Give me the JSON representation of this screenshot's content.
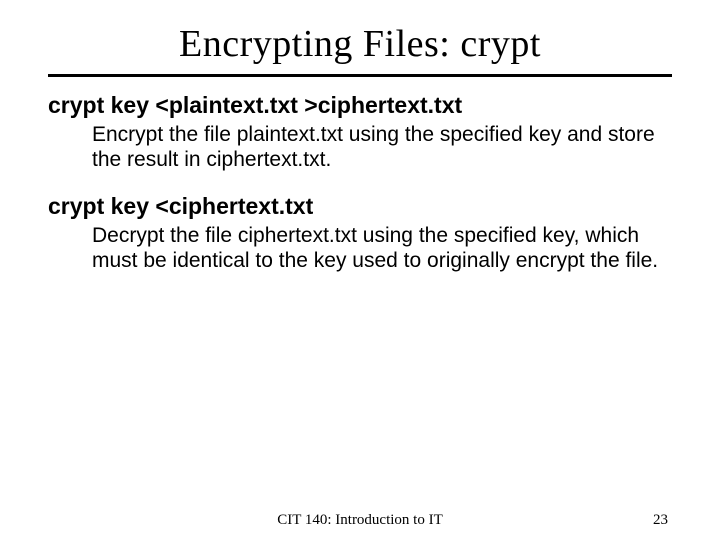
{
  "slide": {
    "title": "Encrypting Files: crypt",
    "sections": [
      {
        "command": "crypt key <plaintext.txt >ciphertext.txt",
        "description": "Encrypt the file plaintext.txt using the specified key and store the result in ciphertext.txt."
      },
      {
        "command": "crypt key <ciphertext.txt",
        "description": "Decrypt the file ciphertext.txt using the specified key, which must be identical to the key used to originally encrypt the file."
      }
    ]
  },
  "footer": {
    "course": "CIT 140: Introduction to IT",
    "page": "23"
  }
}
